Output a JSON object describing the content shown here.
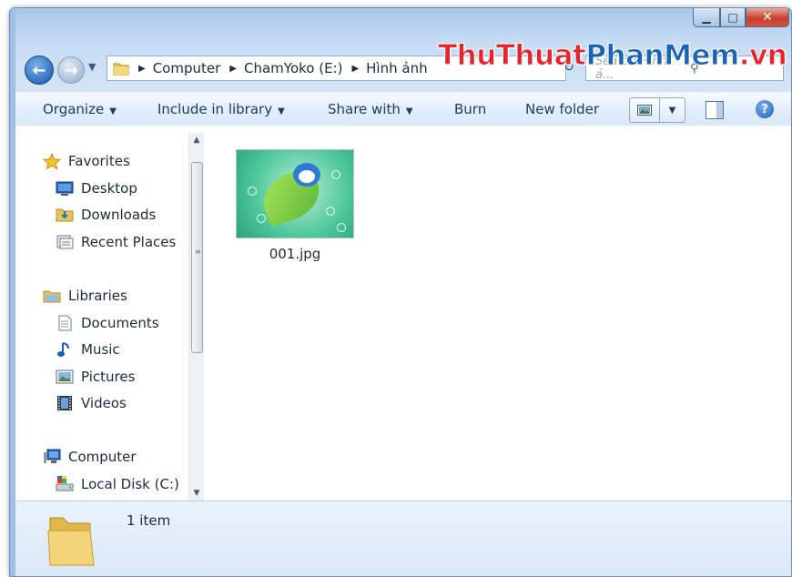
{
  "window": {
    "caption_buttons": {
      "minimize_icon": "minimize-icon",
      "maximize_icon": "maximize-icon",
      "close_icon": "close-icon"
    }
  },
  "watermark": {
    "part1": "ThuThuat",
    "part2": "PhanMem",
    "part3": ".vn"
  },
  "address_bar": {
    "crumbs": [
      {
        "label": "Computer"
      },
      {
        "label": "ChamYoko (E:)"
      },
      {
        "label": "Hình ảnh"
      }
    ]
  },
  "search": {
    "placeholder": "Search Hình ả..."
  },
  "toolbar": {
    "organize": "Organize",
    "include_in_library": "Include in library",
    "share_with": "Share with",
    "burn": "Burn",
    "new_folder": "New folder",
    "help": "?"
  },
  "navigation": {
    "favorites": {
      "label": "Favorites",
      "items": [
        {
          "label": "Desktop"
        },
        {
          "label": "Downloads"
        },
        {
          "label": "Recent Places"
        }
      ]
    },
    "libraries": {
      "label": "Libraries",
      "items": [
        {
          "label": "Documents"
        },
        {
          "label": "Music"
        },
        {
          "label": "Pictures"
        },
        {
          "label": "Videos"
        }
      ]
    },
    "computer": {
      "label": "Computer",
      "items": [
        {
          "label": "Local Disk (C:)"
        }
      ]
    }
  },
  "files": [
    {
      "name": "001.jpg"
    }
  ],
  "details": {
    "count": "1 item"
  },
  "colors": {
    "accent": "#2d6fbe",
    "close": "#c7402b",
    "watermark_red": "#e8242a",
    "watermark_blue": "#1a63b8"
  }
}
